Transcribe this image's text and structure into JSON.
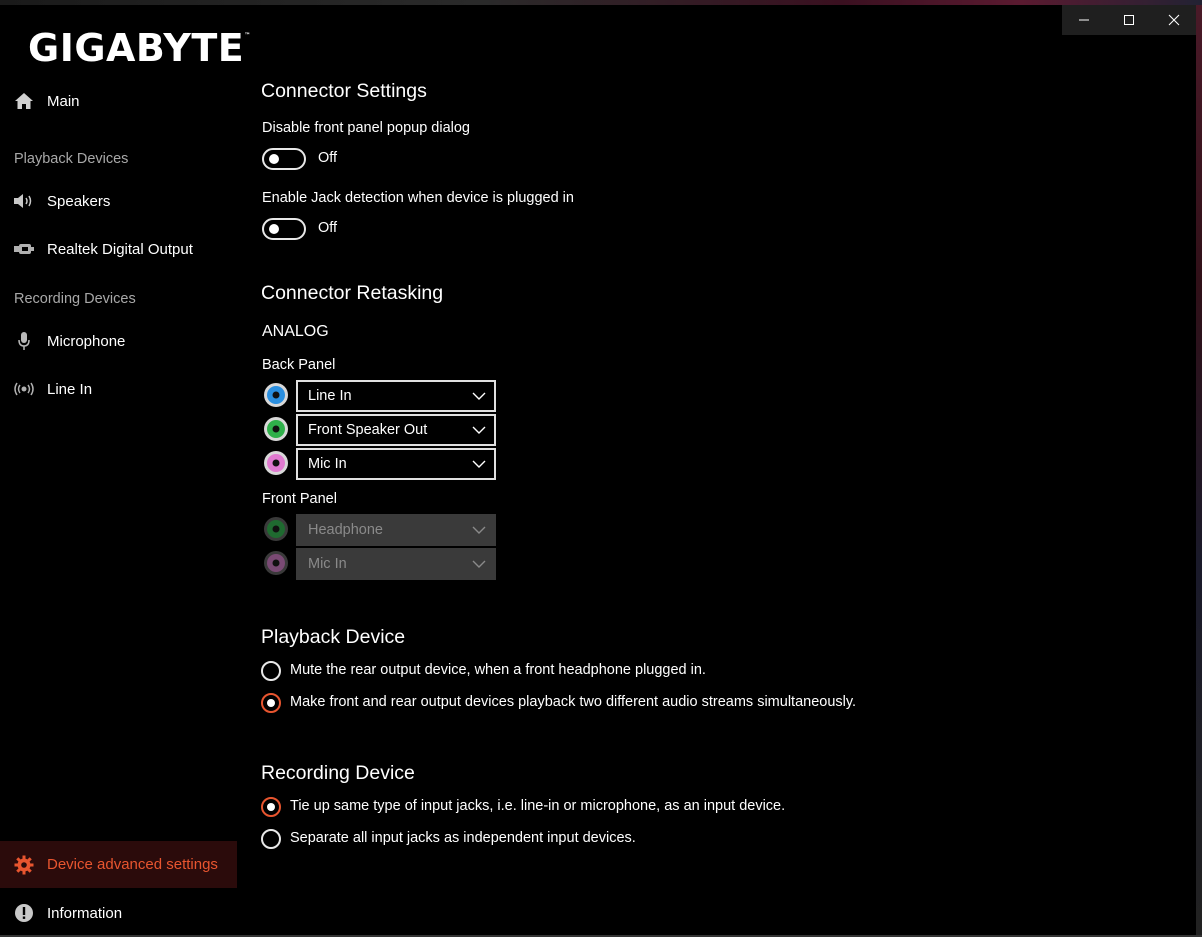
{
  "window": {
    "controls": {
      "minimize_icon": "minimize-icon",
      "maximize_icon": "maximize-icon",
      "close_icon": "close-icon"
    }
  },
  "brand": {
    "logo_text": "GIGABYTE",
    "trademark": "™"
  },
  "sidebar": {
    "main": {
      "label": "Main",
      "icon": "home-icon"
    },
    "playback_section": "Playback Devices",
    "speakers": {
      "label": "Speakers",
      "icon": "speaker-icon"
    },
    "digital_output": {
      "label": "Realtek Digital Output",
      "icon": "digital-output-icon"
    },
    "recording_section": "Recording Devices",
    "microphone": {
      "label": "Microphone",
      "icon": "microphone-icon"
    },
    "line_in": {
      "label": "Line In",
      "icon": "line-in-icon"
    },
    "advanced": {
      "label": "Device advanced settings",
      "icon": "gear-icon"
    },
    "information": {
      "label": "Information",
      "icon": "info-icon"
    }
  },
  "connector_settings": {
    "title": "Connector Settings",
    "popup_label": "Disable front panel popup dialog",
    "popup_state": "Off",
    "jack_label": "Enable Jack detection when device is plugged in",
    "jack_state": "Off"
  },
  "retasking": {
    "title": "Connector Retasking",
    "analog": "ANALOG",
    "back_panel": {
      "label": "Back Panel",
      "jacks": [
        {
          "color": "#2a8fe0",
          "value": "Line In"
        },
        {
          "color": "#2fb04a",
          "value": "Front Speaker Out"
        },
        {
          "color": "#e07ad0",
          "value": "Mic In"
        }
      ]
    },
    "front_panel": {
      "label": "Front Panel",
      "jacks": [
        {
          "color": "#1f6a30",
          "value": "Headphone"
        },
        {
          "color": "#7a4a74",
          "value": "Mic In"
        }
      ]
    }
  },
  "playback_device": {
    "title": "Playback Device",
    "options": [
      {
        "label": "Mute the rear output device, when a front headphone plugged in.",
        "checked": false
      },
      {
        "label": "Make front and rear output devices playback two different audio streams simultaneously.",
        "checked": true
      }
    ]
  },
  "recording_device": {
    "title": "Recording Device",
    "options": [
      {
        "label": "Tie up same type of input jacks, i.e. line-in or microphone, as an input device.",
        "checked": true
      },
      {
        "label": "Separate all input jacks as independent input devices.",
        "checked": false
      }
    ]
  },
  "colors": {
    "accent": "#e8552f",
    "background": "#000000",
    "active_nav_bg": "#2b0b0b"
  }
}
